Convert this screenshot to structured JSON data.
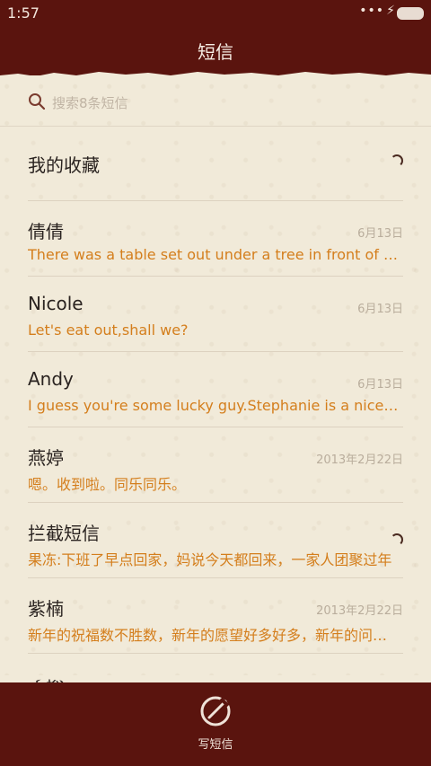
{
  "status_bar": {
    "time": "1:57",
    "signal_dots": "•••",
    "charging_glyph": "⚡"
  },
  "header": {
    "title": "短信"
  },
  "search": {
    "placeholder": "搜索8条短信"
  },
  "favorites": {
    "label": "我的收藏"
  },
  "conversations": [
    {
      "name": "倩倩",
      "date": "6月13日",
      "preview": "There was a table set out under a tree in front of the house"
    },
    {
      "name": "Nicole",
      "date": "6月13日",
      "preview": "Let's eat out,shall we?"
    },
    {
      "name": "Andy",
      "date": "6月13日",
      "preview": "I guess you're some lucky guy.Stephanie is a nice girl."
    },
    {
      "name": "燕婷",
      "date": "2013年2月22日",
      "preview": "嗯。收到啦。同乐同乐。"
    },
    {
      "name": "拦截短信",
      "date": "",
      "preview": "果冻:下班了早点回家，妈说今天都回来，一家人团聚过年"
    },
    {
      "name": "紫楠",
      "date": "2013年2月22日",
      "preview": "新年的祝福数不胜数，新年的愿望好多好多，新年的问候不能少"
    },
    {
      "name": "子玲",
      "date": "",
      "preview": ""
    }
  ],
  "bottom_bar": {
    "compose_label": "写短信",
    "compose_icon": "pen-circle-icon"
  },
  "colors": {
    "frame": "#5a140e",
    "paper": "#f1ead9",
    "accent_orange": "#d47e1c",
    "date_gray": "#b9ad9c"
  }
}
